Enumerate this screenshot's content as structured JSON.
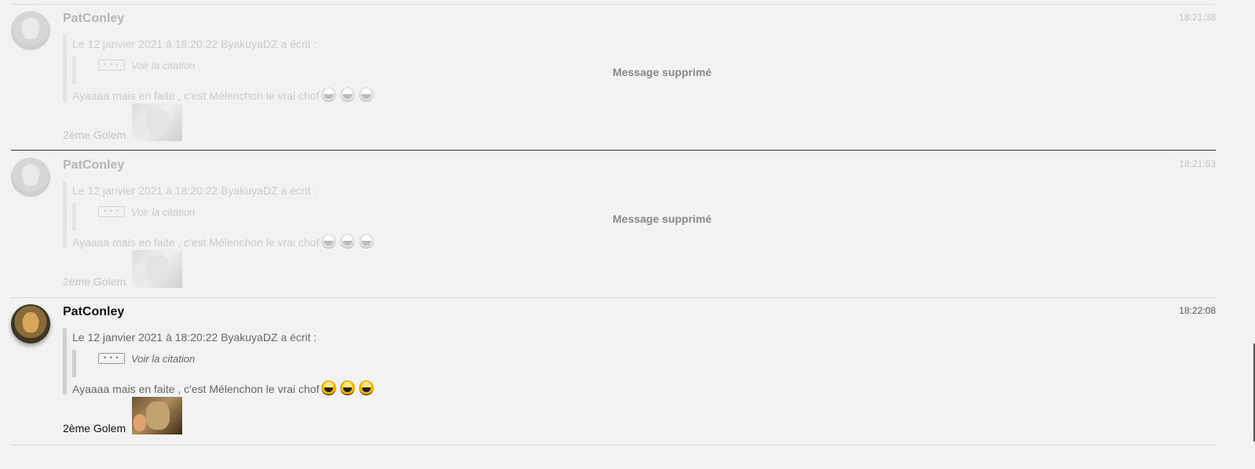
{
  "messages": [
    {
      "author": "PatConley",
      "time": "18:21:38",
      "quote_header": "Le 12 janvier 2021 à 18:20:22 ByakuyaDZ a écrit :",
      "quote_dots": "• • •",
      "quote_link": "Voir la citation",
      "quote_text": "Ayaaaa mais en faite , c'est Mélenchon le vrai chof",
      "signature": "2ème Golem",
      "status": "Message supprimé"
    },
    {
      "author": "PatConley",
      "time": "18:21:53",
      "quote_header": "Le 12 janvier 2021 à 18:20:22 ByakuyaDZ a écrit :",
      "quote_dots": "• • •",
      "quote_link": "Voir la citation",
      "quote_text": "Ayaaaa mais en faite , c'est Mélenchon le vrai chof",
      "signature": "2ème Golem",
      "status": "Message supprimé"
    },
    {
      "author": "PatConley",
      "time": "18:22:08",
      "quote_header": "Le 12 janvier 2021 à 18:20:22 ByakuyaDZ a écrit :",
      "quote_dots": "• • •",
      "quote_link": "Voir la citation",
      "quote_text": "Ayaaaa mais en faite , c'est Mélenchon le vrai chof",
      "signature": "2ème Golem"
    }
  ],
  "icons": {
    "smiley": "laughing-smiley-icon",
    "avatar": "user-avatar"
  }
}
